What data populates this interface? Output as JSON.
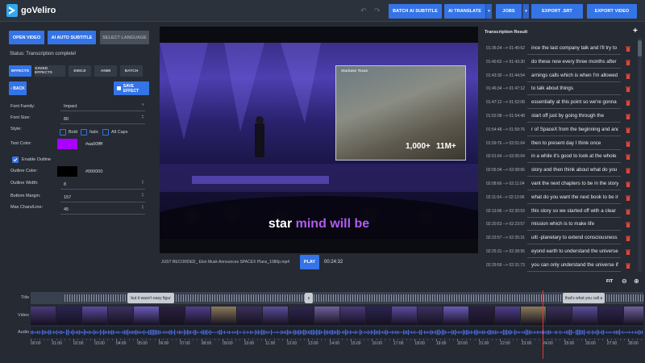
{
  "app": {
    "name": "goVeliro"
  },
  "toolbar": {
    "batch_ai_subtitle": "BATCH AI SUBTITLE",
    "ai_translate": "AI TRANSLATE",
    "jobs": "JOBS",
    "export_srt": "EXPORT .SRT",
    "export_video": "EXPORT VIDEO"
  },
  "left": {
    "open_video": "OPEN VIDEO",
    "ai_auto_subtitle": "AI AUTO SUBTITLE",
    "select_language": "SELECT LANGUAGE",
    "status": "Status: Transcription complete!",
    "tabs": [
      {
        "label": "EFFECTS"
      },
      {
        "label": "SAVED EFFECTS"
      },
      {
        "label": "EMOJI"
      },
      {
        "label": "ANIM"
      },
      {
        "label": "BATCH"
      }
    ],
    "back": "‹ BACK",
    "save_effect": "SAVE EFFECT",
    "font_family_label": "Font Family:",
    "font_family_value": "Impact",
    "font_size_label": "Font Size:",
    "font_size_value": "80",
    "style_label": "Style:",
    "bold_label": "Bold",
    "italic_label": "Italic",
    "allcaps_label": "All Caps",
    "text_color_label": "Text Color:",
    "text_color_value": "#aa00ffff",
    "enable_outline_label": "Enable Outline",
    "outline_color_label": "Outline Color:",
    "outline_color_value": "#000000",
    "outline_width_label": "Outline Width:",
    "outline_width_value": "8",
    "bottom_margin_label": "Bottom Margin:",
    "bottom_margin_value": "157",
    "max_chars_label": "Max Chars/Line:",
    "max_chars_value": "45"
  },
  "colors": {
    "accent": "#3574e6",
    "text_color": "#aa00ff",
    "outline_color": "#000000",
    "delete": "#e0453a"
  },
  "player": {
    "screen_title": "Starbase Texas",
    "stat_left": "1,000+",
    "stat_right": "11M+",
    "caption_white": "star",
    "caption_purple": "mind will be",
    "filename": "JUST RECORDED_ Elon Musk Announces SPACEX Plans_1080p.mp4",
    "play": "PLAY",
    "time": "00:24:32"
  },
  "transcript": {
    "title": "Transcription Result",
    "add": "+",
    "rows": [
      {
        "time": "01:36:24 --> 01:40:62",
        "text": "ince the last company talk and I'll try to"
      },
      {
        "time": "01:40:62 --> 01:43:30",
        "text": "do these now every three months after"
      },
      {
        "time": "01:43:30 --> 01:44:54",
        "text": "arnings calls which is when I'm allowed"
      },
      {
        "time": "01:46:34 --> 01:47:12",
        "text": "to talk about things"
      },
      {
        "time": "01:47:12 --> 01:52:08",
        "text": "essentially at this point so we're gonna"
      },
      {
        "time": "01:52:08 --> 01:54:48",
        "text": "start off just by going through the"
      },
      {
        "time": "01:54:48 --> 01:59:76",
        "text": "r of SpaceX from the beginning and and"
      },
      {
        "time": "01:59:76 --> 02:01:64",
        "text": "then to present day I think once"
      },
      {
        "time": "02:01:64 --> 02:05:04",
        "text": "in a while it's good to look at the whole"
      },
      {
        "time": "02:05:04 --> 02:08:66",
        "text": "story and then think about what do you"
      },
      {
        "time": "02:08:66 --> 02:11:04",
        "text": "vant the next chapters to be in the story"
      },
      {
        "time": "02:11:04 --> 02:13:96",
        "text": "what do you want the next book to be in"
      },
      {
        "time": "02:13:96 --> 02:20:53",
        "text": "this story so we started off with a clear"
      },
      {
        "time": "02:20:53 --> 02:23:57",
        "text": "mission which is to make life"
      },
      {
        "time": "02:23:57 --> 02:25:31",
        "text": "ulti -planetary to extend consciousness"
      },
      {
        "time": "02:25:31 --> 02:28:95",
        "text": "eyond earth to understand the universe"
      },
      {
        "time": "02:29:59 --> 02:31:73",
        "text": "you can only understand the universe if"
      }
    ]
  },
  "timeline": {
    "fit": "FIT",
    "zoom_out_icon": "zoom-out-icon",
    "zoom_in_icon": "zoom-in-icon",
    "title_label": "Title",
    "video_label": "Video",
    "audio_label": "Audio",
    "segments": [
      {
        "text": "but it wasn't easy figur"
      },
      {
        "text": "s"
      },
      {
        "text": "that's what you call a"
      }
    ],
    "ticks": [
      "00:00",
      "01:00",
      "02:00",
      "03:00",
      "04:00",
      "05:00",
      "06:00",
      "07:00",
      "08:00",
      "09:00",
      "10:00",
      "11:00",
      "12:00",
      "13:00",
      "14:00",
      "15:00",
      "16:00",
      "17:00",
      "18:00",
      "19:00",
      "20:00",
      "21:00",
      "22:00",
      "23:00",
      "24:00",
      "25:00",
      "26:00",
      "27:00",
      "28:00"
    ]
  }
}
